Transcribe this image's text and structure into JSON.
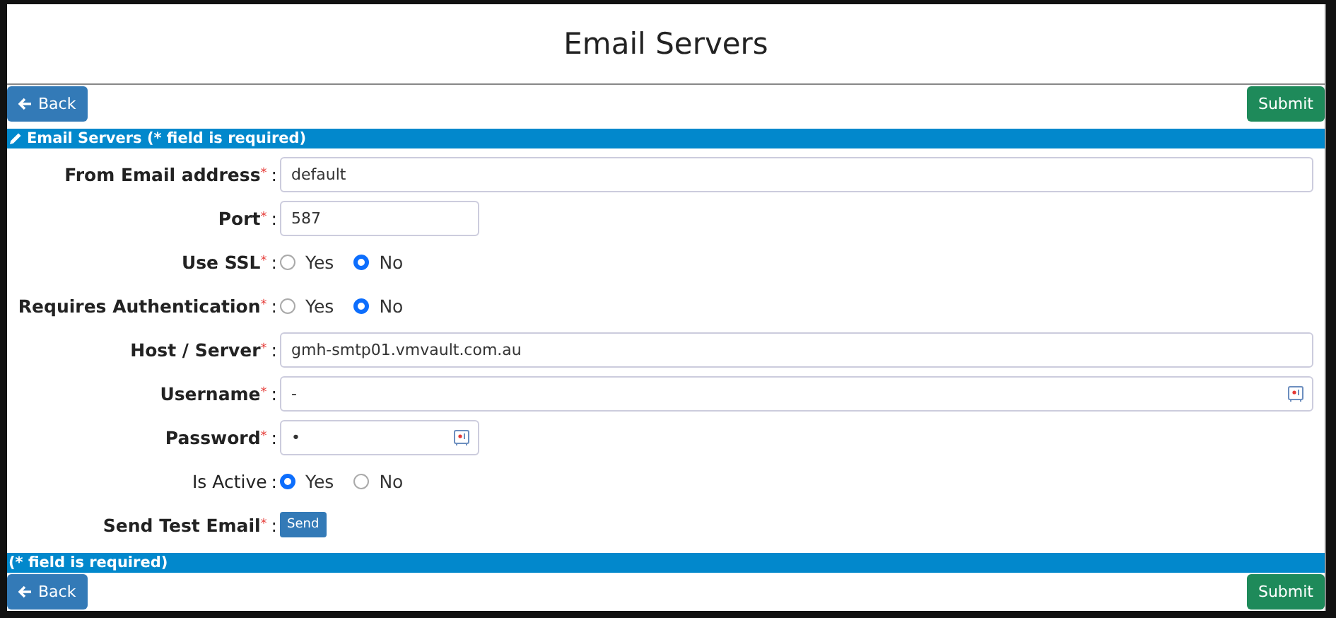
{
  "title": "Email Servers",
  "toolbar_top": {
    "back": "Back",
    "submit": "Submit"
  },
  "header": {
    "text": "Email Servers (* field is required)"
  },
  "fields": [
    {
      "kind": "text",
      "label": "From Email address",
      "bold": true,
      "mark": "*",
      "colon": ":",
      "value": "default"
    },
    {
      "kind": "number",
      "label": "Port",
      "bold": true,
      "mark": "*",
      "colon": ":",
      "value": "587"
    },
    {
      "kind": "radio",
      "label": "Use SSL",
      "bold": true,
      "mark": "*",
      "colon": ":",
      "options": [
        {
          "label": "Yes",
          "selected": false
        },
        {
          "label": "No",
          "selected": true
        }
      ]
    },
    {
      "kind": "radio",
      "label": "Requires Authentication",
      "bold": true,
      "mark": "*",
      "colon": ":",
      "options": [
        {
          "label": "Yes",
          "selected": false
        },
        {
          "label": "No",
          "selected": true
        }
      ]
    },
    {
      "kind": "text",
      "label": "Host / Server",
      "bold": true,
      "mark": "*",
      "colon": ":",
      "value": "gmh-smtp01.vmvault.com.au"
    },
    {
      "kind": "username",
      "label": "Username",
      "bold": true,
      "mark": "*",
      "colon": ":",
      "value": "-"
    },
    {
      "kind": "password",
      "label": "Password",
      "bold": true,
      "mark": "*",
      "colon": ":",
      "value": "•"
    },
    {
      "kind": "radio",
      "label": "Is Active",
      "bold": false,
      "colon": ":",
      "options": [
        {
          "label": "Yes",
          "selected": true
        },
        {
          "label": "No",
          "selected": false
        }
      ]
    },
    {
      "kind": "button",
      "label": "Send Test Email",
      "bold": true,
      "mark": "*",
      "colon": ":",
      "button": "Send"
    }
  ],
  "footer": {
    "text": "(* field is required)"
  },
  "toolbar_bottom": {
    "back": "Back",
    "submit": "Submit"
  }
}
